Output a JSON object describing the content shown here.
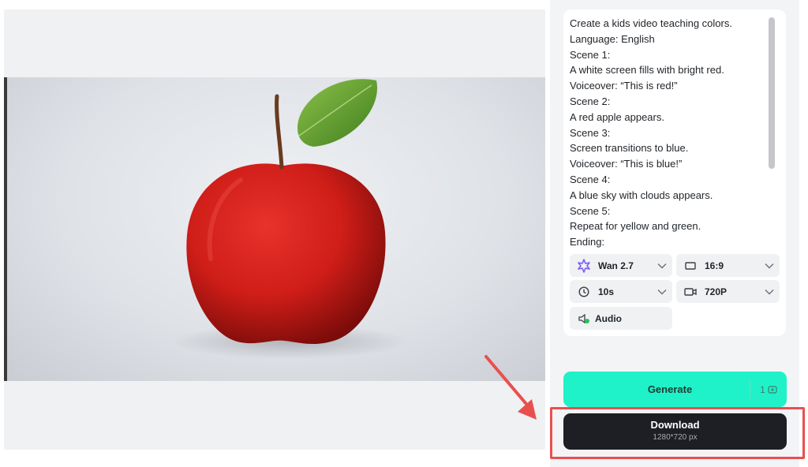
{
  "prompt": {
    "lines": [
      "Create a kids video teaching colors.",
      "Language: English",
      "Scene 1:",
      "A white screen fills with bright red.",
      "Voiceover: “This is red!”",
      "Scene 2:",
      "A red apple appears.",
      "Scene 3:",
      "Screen transitions to blue.",
      "Voiceover: “This is blue!”",
      "Scene 4:",
      "A blue sky with clouds appears.",
      "Scene 5:",
      "Repeat for yellow and green.",
      "Ending:"
    ]
  },
  "options": {
    "model": {
      "value": "Wan 2.7",
      "icon": "model-logo-icon"
    },
    "aspect_ratio": {
      "value": "16:9",
      "icon": "aspect-ratio-icon"
    },
    "duration": {
      "value": "10s",
      "icon": "clock-icon"
    },
    "resolution": {
      "value": "720P",
      "icon": "video-camera-icon"
    },
    "audio": {
      "value": "Audio",
      "icon": "audio-icon"
    }
  },
  "generate": {
    "label": "Generate",
    "cost": "1"
  },
  "download": {
    "label": "Download",
    "resolution": "1280*720 px"
  },
  "colors": {
    "generate_bg": "#1ff2c8",
    "download_bg": "#1d1f24",
    "highlight_red": "#e8504e"
  }
}
